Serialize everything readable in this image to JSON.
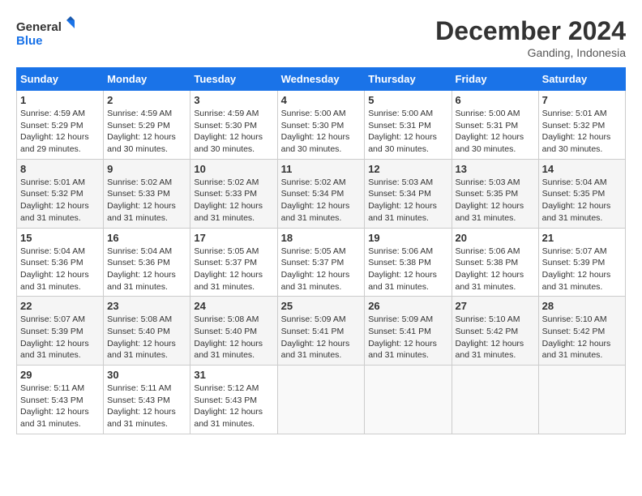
{
  "logo": {
    "line1": "General",
    "line2": "Blue"
  },
  "title": "December 2024",
  "location": "Ganding, Indonesia",
  "days_of_week": [
    "Sunday",
    "Monday",
    "Tuesday",
    "Wednesday",
    "Thursday",
    "Friday",
    "Saturday"
  ],
  "weeks": [
    [
      {
        "day": "1",
        "sunrise": "4:59 AM",
        "sunset": "5:29 PM",
        "daylight": "12 hours and 29 minutes."
      },
      {
        "day": "2",
        "sunrise": "4:59 AM",
        "sunset": "5:29 PM",
        "daylight": "12 hours and 30 minutes."
      },
      {
        "day": "3",
        "sunrise": "4:59 AM",
        "sunset": "5:30 PM",
        "daylight": "12 hours and 30 minutes."
      },
      {
        "day": "4",
        "sunrise": "5:00 AM",
        "sunset": "5:30 PM",
        "daylight": "12 hours and 30 minutes."
      },
      {
        "day": "5",
        "sunrise": "5:00 AM",
        "sunset": "5:31 PM",
        "daylight": "12 hours and 30 minutes."
      },
      {
        "day": "6",
        "sunrise": "5:00 AM",
        "sunset": "5:31 PM",
        "daylight": "12 hours and 30 minutes."
      },
      {
        "day": "7",
        "sunrise": "5:01 AM",
        "sunset": "5:32 PM",
        "daylight": "12 hours and 30 minutes."
      }
    ],
    [
      {
        "day": "8",
        "sunrise": "5:01 AM",
        "sunset": "5:32 PM",
        "daylight": "12 hours and 31 minutes."
      },
      {
        "day": "9",
        "sunrise": "5:02 AM",
        "sunset": "5:33 PM",
        "daylight": "12 hours and 31 minutes."
      },
      {
        "day": "10",
        "sunrise": "5:02 AM",
        "sunset": "5:33 PM",
        "daylight": "12 hours and 31 minutes."
      },
      {
        "day": "11",
        "sunrise": "5:02 AM",
        "sunset": "5:34 PM",
        "daylight": "12 hours and 31 minutes."
      },
      {
        "day": "12",
        "sunrise": "5:03 AM",
        "sunset": "5:34 PM",
        "daylight": "12 hours and 31 minutes."
      },
      {
        "day": "13",
        "sunrise": "5:03 AM",
        "sunset": "5:35 PM",
        "daylight": "12 hours and 31 minutes."
      },
      {
        "day": "14",
        "sunrise": "5:04 AM",
        "sunset": "5:35 PM",
        "daylight": "12 hours and 31 minutes."
      }
    ],
    [
      {
        "day": "15",
        "sunrise": "5:04 AM",
        "sunset": "5:36 PM",
        "daylight": "12 hours and 31 minutes."
      },
      {
        "day": "16",
        "sunrise": "5:04 AM",
        "sunset": "5:36 PM",
        "daylight": "12 hours and 31 minutes."
      },
      {
        "day": "17",
        "sunrise": "5:05 AM",
        "sunset": "5:37 PM",
        "daylight": "12 hours and 31 minutes."
      },
      {
        "day": "18",
        "sunrise": "5:05 AM",
        "sunset": "5:37 PM",
        "daylight": "12 hours and 31 minutes."
      },
      {
        "day": "19",
        "sunrise": "5:06 AM",
        "sunset": "5:38 PM",
        "daylight": "12 hours and 31 minutes."
      },
      {
        "day": "20",
        "sunrise": "5:06 AM",
        "sunset": "5:38 PM",
        "daylight": "12 hours and 31 minutes."
      },
      {
        "day": "21",
        "sunrise": "5:07 AM",
        "sunset": "5:39 PM",
        "daylight": "12 hours and 31 minutes."
      }
    ],
    [
      {
        "day": "22",
        "sunrise": "5:07 AM",
        "sunset": "5:39 PM",
        "daylight": "12 hours and 31 minutes."
      },
      {
        "day": "23",
        "sunrise": "5:08 AM",
        "sunset": "5:40 PM",
        "daylight": "12 hours and 31 minutes."
      },
      {
        "day": "24",
        "sunrise": "5:08 AM",
        "sunset": "5:40 PM",
        "daylight": "12 hours and 31 minutes."
      },
      {
        "day": "25",
        "sunrise": "5:09 AM",
        "sunset": "5:41 PM",
        "daylight": "12 hours and 31 minutes."
      },
      {
        "day": "26",
        "sunrise": "5:09 AM",
        "sunset": "5:41 PM",
        "daylight": "12 hours and 31 minutes."
      },
      {
        "day": "27",
        "sunrise": "5:10 AM",
        "sunset": "5:42 PM",
        "daylight": "12 hours and 31 minutes."
      },
      {
        "day": "28",
        "sunrise": "5:10 AM",
        "sunset": "5:42 PM",
        "daylight": "12 hours and 31 minutes."
      }
    ],
    [
      {
        "day": "29",
        "sunrise": "5:11 AM",
        "sunset": "5:43 PM",
        "daylight": "12 hours and 31 minutes."
      },
      {
        "day": "30",
        "sunrise": "5:11 AM",
        "sunset": "5:43 PM",
        "daylight": "12 hours and 31 minutes."
      },
      {
        "day": "31",
        "sunrise": "5:12 AM",
        "sunset": "5:43 PM",
        "daylight": "12 hours and 31 minutes."
      },
      null,
      null,
      null,
      null
    ]
  ],
  "labels": {
    "sunrise": "Sunrise:",
    "sunset": "Sunset:",
    "daylight": "Daylight:"
  }
}
